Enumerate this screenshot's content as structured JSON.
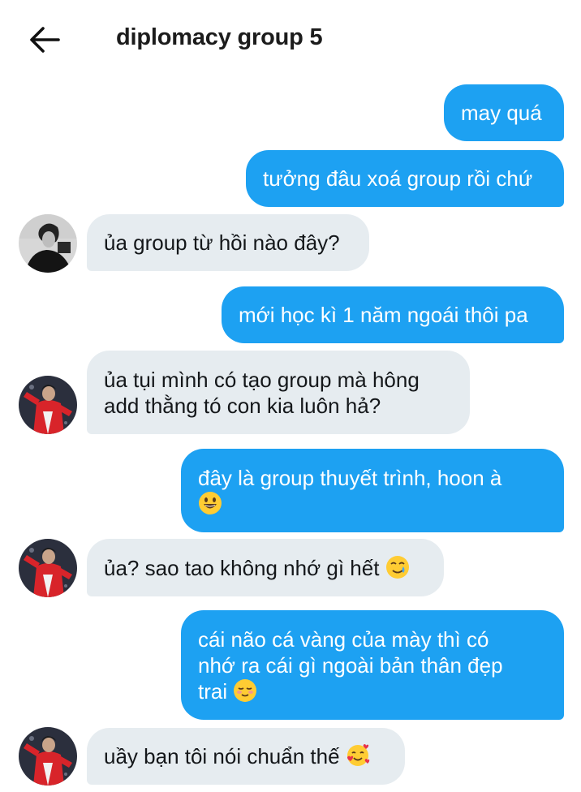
{
  "header": {
    "title": "diplomacy group 5",
    "back_icon": "arrow-left-icon"
  },
  "messages": [
    {
      "sender": "me",
      "lines": [
        "may quá"
      ]
    },
    {
      "sender": "me",
      "lines": [
        "tưởng đâu xoá group rồi chứ"
      ]
    },
    {
      "sender": "friend-bw",
      "lines": [
        "ủa group từ hồi nào đây?"
      ]
    },
    {
      "sender": "me",
      "lines": [
        "mới học kì 1 năm ngoái thôi pa"
      ]
    },
    {
      "sender": "friend-red",
      "lines": [
        "ủa tụi mình có tạo group mà hông",
        "add thằng tó con kia luôn hả?"
      ]
    },
    {
      "sender": "me",
      "lines": [
        "đây là group thuyết trình, hoon à",
        ""
      ],
      "emoji": "grinning-face"
    },
    {
      "sender": "friend-red",
      "lines": [
        "ủa? sao tao không nhớ gì hết "
      ],
      "emoji": "smiling-face-with-tear"
    },
    {
      "sender": "me",
      "lines": [
        "cái não cá vàng của mày thì có",
        "nhớ ra cái gì ngoài bản thân đẹp",
        "trai "
      ],
      "emoji": "smiling-face-blushing"
    },
    {
      "sender": "friend-red",
      "lines": [
        "uầy bạn tôi nói chuẩn thế "
      ],
      "emoji": "smiling-face-with-hearts"
    }
  ],
  "colors": {
    "outgoing_bubble": "#1da1f2",
    "incoming_bubble": "#e6ecf0",
    "outgoing_text": "#ffffff",
    "incoming_text": "#14171a"
  }
}
